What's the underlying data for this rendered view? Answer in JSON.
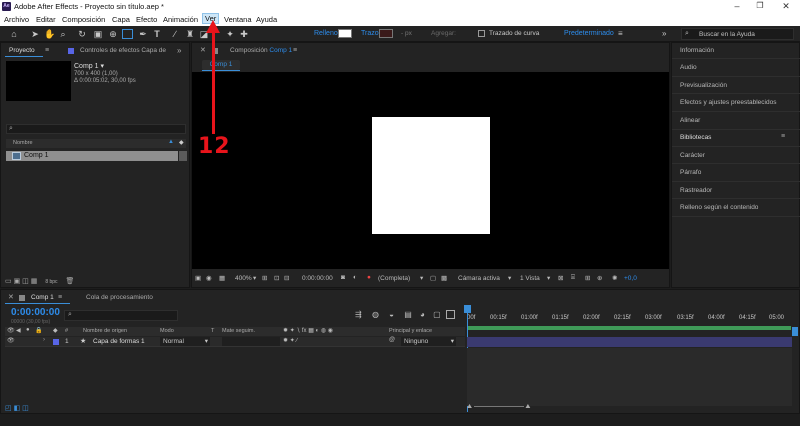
{
  "window": {
    "title": "Adobe After Effects - Proyecto sin título.aep *",
    "logo": "Ae"
  },
  "menu": [
    "Archivo",
    "Editar",
    "Composición",
    "Capa",
    "Efecto",
    "Animación",
    "Ver",
    "Ventana",
    "Ayuda"
  ],
  "toolbar": {
    "fill_label": "Relleno",
    "stroke_label": "Trazo",
    "px_label": "- px",
    "add_label": "Agregar:",
    "curve_label": "Trazado de curva",
    "workspace": "Predeterminado",
    "help_placeholder": "Buscar en la Ayuda"
  },
  "project": {
    "tab_project": "Proyecto",
    "tab_effects": "Controles de efectos Capa de",
    "comp_name": "Comp 1",
    "comp_info1": "700 x 400 (1,00)",
    "comp_info2": "Δ 0:00:05:02, 30,00 fps",
    "col_name": "Nombre",
    "item": "Comp 1",
    "bpc": "8 bpc"
  },
  "viewer": {
    "tab": "Composición",
    "tab_comp": "Comp 1",
    "breadcrumb": "Comp 1",
    "zoom": "400%",
    "timecode": "0:00:00:00",
    "resolution": "(Completa)",
    "camera": "Cámara activa",
    "views": "1 Vista",
    "offset": "+0,0"
  },
  "right_panel": [
    "Información",
    "Audio",
    "Previsualización",
    "Efectos y ajustes preestablecidos",
    "Alinear",
    "Bibliotecas",
    "Carácter",
    "Párrafo",
    "Rastreador",
    "Relleno según el contenido"
  ],
  "timeline": {
    "tab_comp": "Comp 1",
    "tab_queue": "Cola de procesamiento",
    "timecode": "0:00:00:00",
    "timecode_sub": "00000 (30,00 fps)",
    "col_source": "Nombre de origen",
    "col_mode": "Modo",
    "col_t": "T",
    "col_matte": "Mate seguim.",
    "col_parent": "Principal y enlace",
    "layer_num": "1",
    "layer_name": "Capa de formas 1",
    "layer_mode": "Normal",
    "layer_parent": "Ninguno",
    "ruler": [
      "00f",
      "00:15f",
      "01:00f",
      "01:15f",
      "02:00f",
      "02:15f",
      "03:00f",
      "03:15f",
      "04:00f",
      "04:15f",
      "05:00"
    ]
  },
  "annotation": "12",
  "colors": {
    "accent": "#2d8ceb",
    "annotation": "#e8141b",
    "layer_label": "#5865e6",
    "workarea": "#3f9a58"
  }
}
